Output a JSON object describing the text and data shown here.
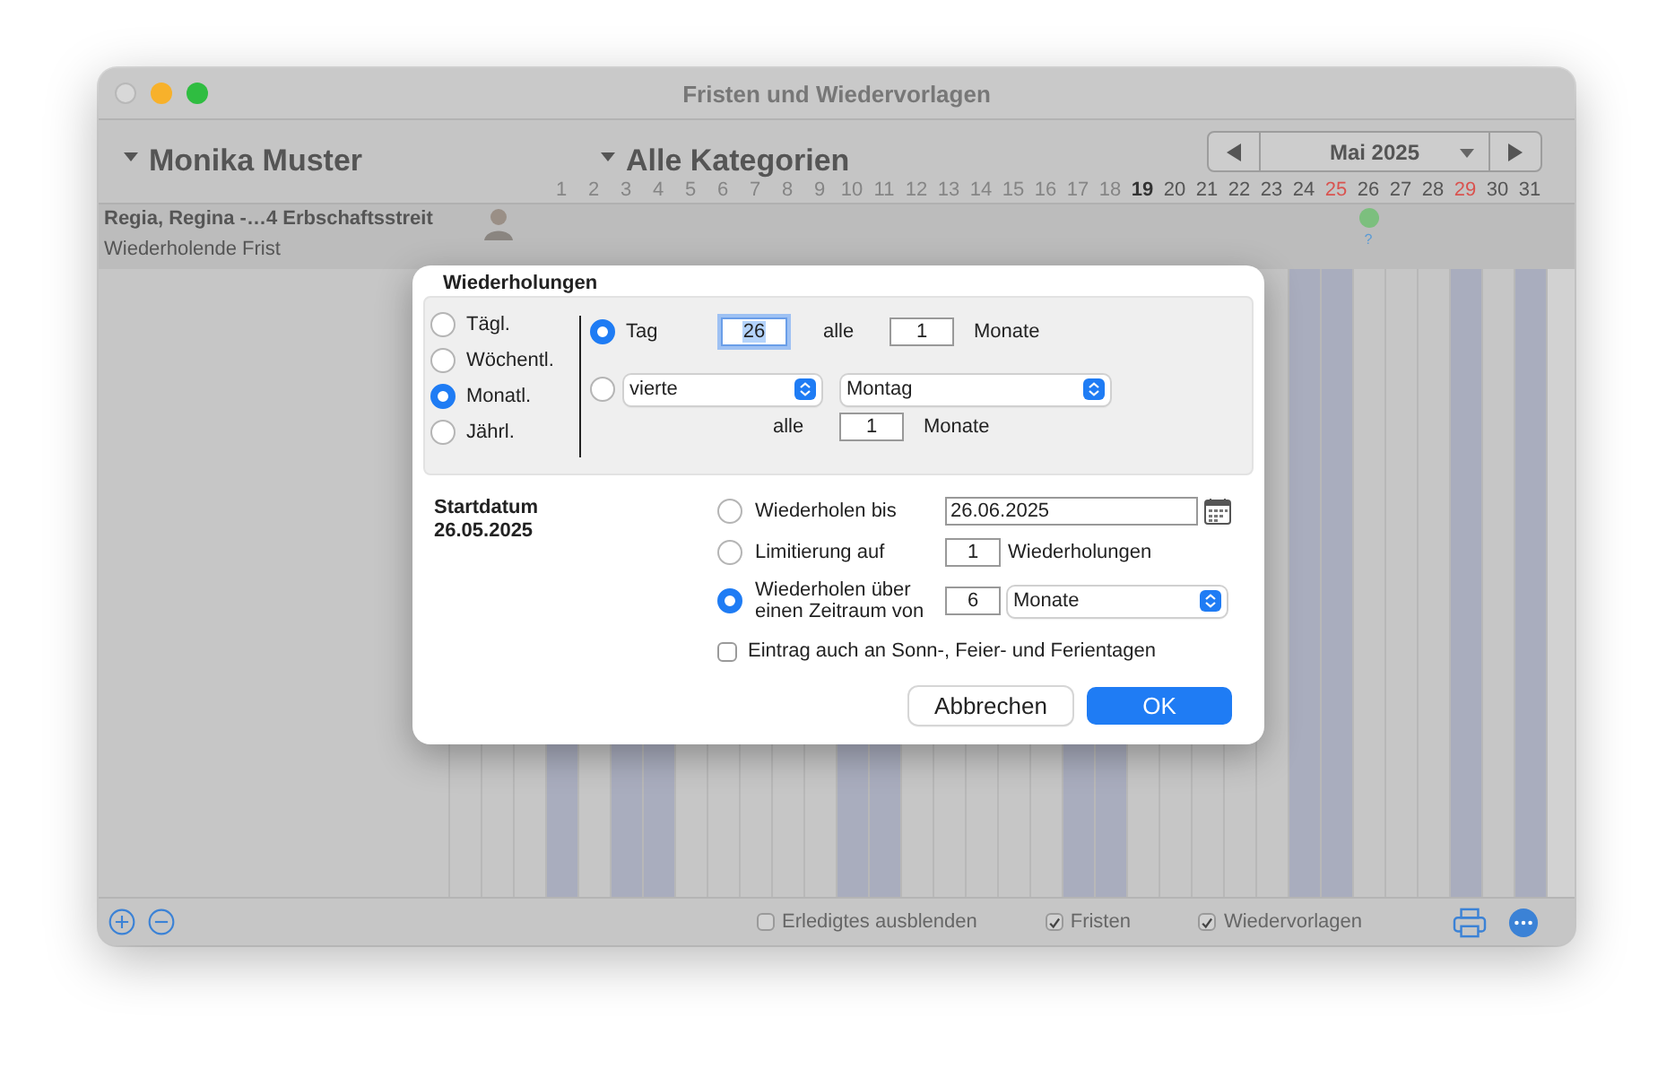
{
  "window": {
    "title": "Fristen und Wiedervorlagen"
  },
  "toolbar": {
    "person": "Monika Muster",
    "category": "Alle Kategorien",
    "month": "Mai 2025"
  },
  "days": [
    {
      "label": "1",
      "kind": "past",
      "shaded": true
    },
    {
      "label": "2",
      "kind": "past",
      "shaded": false
    },
    {
      "label": "3",
      "kind": "past",
      "shaded": true
    },
    {
      "label": "4",
      "kind": "past",
      "shaded": true
    },
    {
      "label": "5",
      "kind": "past",
      "shaded": false
    },
    {
      "label": "6",
      "kind": "past",
      "shaded": false
    },
    {
      "label": "7",
      "kind": "past",
      "shaded": false
    },
    {
      "label": "8",
      "kind": "past",
      "shaded": false
    },
    {
      "label": "9",
      "kind": "past",
      "shaded": false
    },
    {
      "label": "10",
      "kind": "past",
      "shaded": true
    },
    {
      "label": "11",
      "kind": "past",
      "shaded": true
    },
    {
      "label": "12",
      "kind": "past",
      "shaded": false
    },
    {
      "label": "13",
      "kind": "past",
      "shaded": false
    },
    {
      "label": "14",
      "kind": "past",
      "shaded": false
    },
    {
      "label": "15",
      "kind": "past",
      "shaded": false
    },
    {
      "label": "16",
      "kind": "past",
      "shaded": false
    },
    {
      "label": "17",
      "kind": "past",
      "shaded": true
    },
    {
      "label": "18",
      "kind": "past",
      "shaded": true
    },
    {
      "label": "19",
      "kind": "today",
      "shaded": false
    },
    {
      "label": "20",
      "kind": "normal",
      "shaded": false
    },
    {
      "label": "21",
      "kind": "normal",
      "shaded": false
    },
    {
      "label": "22",
      "kind": "normal",
      "shaded": false
    },
    {
      "label": "23",
      "kind": "normal",
      "shaded": false
    },
    {
      "label": "24",
      "kind": "normal",
      "shaded": true
    },
    {
      "label": "25",
      "kind": "holiday",
      "shaded": true
    },
    {
      "label": "26",
      "kind": "normal",
      "shaded": false,
      "mark": {
        "color": "#7cbf7e",
        "note": "?"
      }
    },
    {
      "label": "27",
      "kind": "normal",
      "shaded": false
    },
    {
      "label": "28",
      "kind": "normal",
      "shaded": false
    },
    {
      "label": "29",
      "kind": "holiday",
      "shaded": true
    },
    {
      "label": "30",
      "kind": "normal",
      "shaded": false
    },
    {
      "label": "31",
      "kind": "normal",
      "shaded": true
    }
  ],
  "entry": {
    "title": "Regia, Regina -…4 Erbschaftsstreit",
    "subtitle": "Wiederholende Frist"
  },
  "filters": [
    {
      "label": "Erledigtes ausblenden",
      "checked": false
    },
    {
      "label": "Fristen",
      "checked": true
    },
    {
      "label": "Wiedervorlagen",
      "checked": true
    }
  ],
  "dialog": {
    "title": "Wiederholungen",
    "frequencies": [
      {
        "label": "Tägl.",
        "selected": false
      },
      {
        "label": "Wöchentl.",
        "selected": false
      },
      {
        "label": "Monatl.",
        "selected": true
      },
      {
        "label": "Jährl.",
        "selected": false
      }
    ],
    "by_day": {
      "selected": true,
      "label": "Tag",
      "day": "26",
      "every_label": "alle",
      "every": "1",
      "unit": "Monate"
    },
    "by_weekday": {
      "selected": false,
      "ordinal": "vierte",
      "weekday": "Montag",
      "every_label": "alle",
      "every": "1",
      "unit": "Monate"
    },
    "start": {
      "label": "Startdatum",
      "date": "26.05.2025"
    },
    "end_options": [
      {
        "kind": "date",
        "label": "Wiederholen bis",
        "selected": false,
        "value": "26.06.2025"
      },
      {
        "kind": "count",
        "label": "Limitierung auf",
        "selected": false,
        "value": "1",
        "unit": "Wiederholungen"
      },
      {
        "kind": "period",
        "label": "Wiederholen über einen Zeitraum von",
        "selected": true,
        "value": "6",
        "unit": "Monate"
      }
    ],
    "include_holidays": {
      "label": "Eintrag auch an Sonn-, Feier- und Ferientagen",
      "checked": false
    },
    "buttons": [
      {
        "label": "Abbrechen",
        "kind": "cancel"
      },
      {
        "label": "OK",
        "kind": "default"
      }
    ]
  }
}
